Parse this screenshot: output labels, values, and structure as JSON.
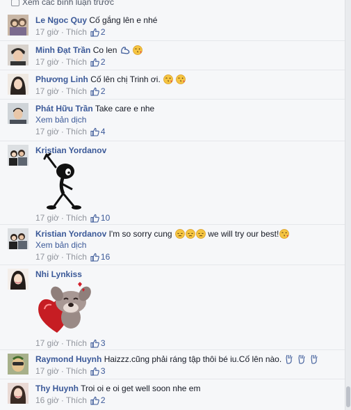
{
  "prev_link": "Xem các bình luận trước",
  "comments": [
    {
      "author": "Le Ngoc Quy",
      "text": "Cố gắng lên e nhé",
      "time": "17 giờ",
      "like": "Thích",
      "count": "2"
    },
    {
      "author": "Minh Đạt Trần",
      "text": "Co len",
      "time": "17 giờ",
      "like": "Thích",
      "count": "2"
    },
    {
      "author": "Phương Linh",
      "text": "Cố lên chị Trinh ơi.",
      "time": "17 giờ",
      "like": "Thích",
      "count": "2"
    },
    {
      "author": "Phát Hữu Trần",
      "text": "Take care e nhe",
      "translate": "Xem bản dịch",
      "time": "17 giờ",
      "like": "Thích",
      "count": "4"
    },
    {
      "author": "Kristian Yordanov",
      "text": "",
      "time": "17 giờ",
      "like": "Thích",
      "count": "10"
    },
    {
      "author": "Kristian Yordanov",
      "text": "I'm so sorry cung",
      "text2": "we will try our best!",
      "translate": "Xem bản dịch",
      "time": "17 giờ",
      "like": "Thích",
      "count": "16"
    },
    {
      "author": "Nhi Lynkiss",
      "text": "",
      "time": "17 giờ",
      "like": "Thích",
      "count": "3"
    },
    {
      "author": "Raymond Huynh",
      "text": "Haizzz.cũng phải ráng tập thôi bé iu.Cố lên nào.",
      "time": "17 giờ",
      "like": "Thích",
      "count": "3"
    },
    {
      "author": "Thy Huynh",
      "text": "Troi oi e oi get well soon nhe em",
      "time": "16 giờ",
      "like": "Thích",
      "count": "2"
    }
  ],
  "icons": {
    "like": "thumbs-up-icon",
    "emoji_kiss": "kiss-emoji-icon",
    "emoji_pensive": "pensive-emoji-icon",
    "emoji_flex": "flexed-biceps-icon",
    "emoji_hand": "raised-hand-icon"
  },
  "colors": {
    "link": "#3b5998",
    "meta": "#90949c",
    "background": "#f6f7f9"
  }
}
